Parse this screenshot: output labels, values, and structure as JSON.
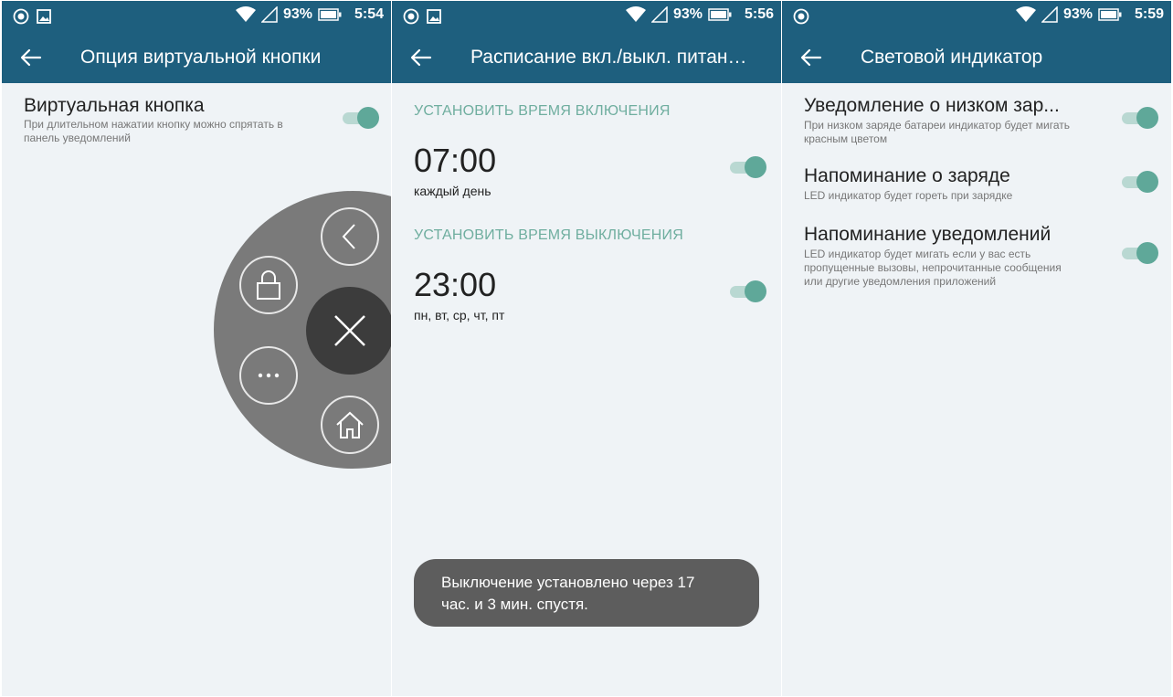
{
  "panels": [
    {
      "status": {
        "battery": "93%",
        "time": "5:54"
      },
      "title": "Опция виртуальной кнопки",
      "row": {
        "title": "Виртуальная кнопка",
        "subtitle_line1": "При длительном нажатии кнопку можно спрятать в",
        "subtitle_line2": "панель уведомлений",
        "toggle_on": true
      },
      "virtual_button_icons": [
        "chevron-left-icon",
        "lock-icon",
        "close-icon",
        "more-icon",
        "home-icon"
      ]
    },
    {
      "status": {
        "battery": "93%",
        "time": "5:56"
      },
      "title": "Расписание вкл./выкл. питан…",
      "on_section": "УСТАНОВИТЬ ВРЕМЯ ВКЛЮЧЕНИЯ",
      "on_time": "07:00",
      "on_days": "каждый день",
      "off_section": "УСТАНОВИТЬ ВРЕМЯ ВЫКЛЮЧЕНИЯ",
      "off_time": "23:00",
      "off_days": "пн, вт, ср, чт, пт",
      "toast_line1": "Выключение установлено через 17",
      "toast_line2": "час. и  3 мин. спустя."
    },
    {
      "status": {
        "battery": "93%",
        "time": "5:59"
      },
      "title": "Световой индикатор",
      "rows": [
        {
          "title": "Уведомление о низком зар...",
          "sub1": "При низком заряде батареи индикатор будет мигать",
          "sub2": "красным цветом",
          "sub3": ""
        },
        {
          "title": "Напоминание о заряде",
          "sub1": "LED индикатор будет гореть при зарядке",
          "sub2": "",
          "sub3": ""
        },
        {
          "title": "Напоминание уведомлений",
          "sub1": "LED индикатор будет мигать если у вас есть",
          "sub2": "пропущенные вызовы, непрочитанные сообщения",
          "sub3": "или другие уведомления приложений"
        }
      ]
    }
  ],
  "colors": {
    "appbar": "#1e5f7e",
    "accent": "#5fa899",
    "background": "#eff3f6",
    "toast": "#5d5d5d"
  }
}
